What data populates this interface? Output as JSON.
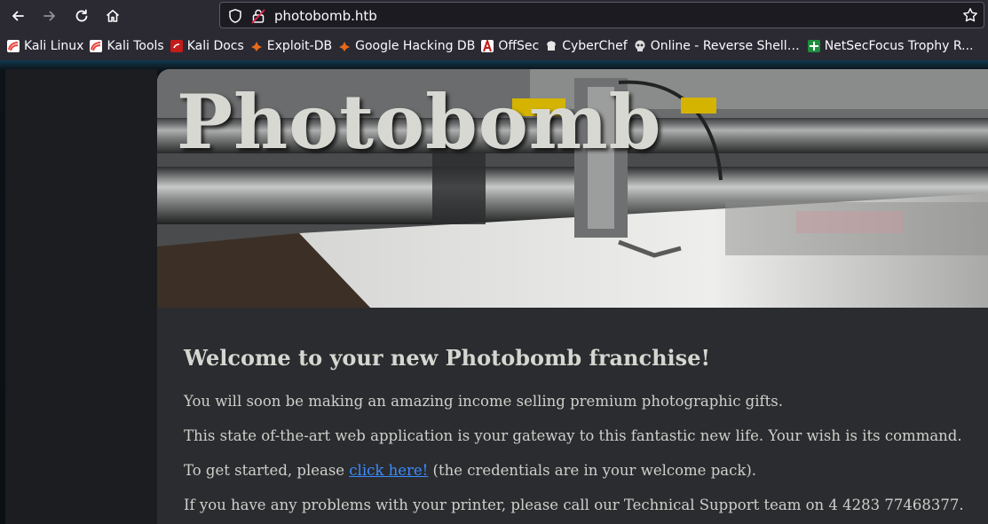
{
  "browser": {
    "url": "photobomb.htb",
    "bookmarks": [
      {
        "label": "Kali Linux",
        "icon": "kali-icon",
        "color": "#e8473e"
      },
      {
        "label": "Kali Tools",
        "icon": "kali-icon",
        "color": "#e8473e"
      },
      {
        "label": "Kali Docs",
        "icon": "kali-docs-icon",
        "color": "#c41b1b"
      },
      {
        "label": "Exploit-DB",
        "icon": "exploit-db-icon",
        "color": "#e86a19"
      },
      {
        "label": "Google Hacking DB",
        "icon": "ghdb-icon",
        "color": "#e86a19"
      },
      {
        "label": "OffSec",
        "icon": "offsec-icon",
        "color": "#c41b1b"
      },
      {
        "label": "CyberChef",
        "icon": "cyberchef-icon",
        "color": "#dddddd"
      },
      {
        "label": "Online - Reverse Shell ...",
        "icon": "skull-icon",
        "color": "#dddddd"
      },
      {
        "label": "NetSecFocus Trophy R...",
        "icon": "netsecfocus-icon",
        "color": "#1e8e3e"
      }
    ]
  },
  "page": {
    "hero_title": "Photobomb",
    "heading": "Welcome to your new Photobomb franchise!",
    "para1": "You will soon be making an amazing income selling premium photographic gifts.",
    "para2": "This state of-the-art web application is your gateway to this fantastic new life. Your wish is its command.",
    "para3_before": "To get started, please ",
    "para3_link": "click here!",
    "para3_after": " (the credentials are in your welcome pack).",
    "para4": "If you have any problems with your printer, please call our Technical Support team on 4 4283 77468377."
  }
}
